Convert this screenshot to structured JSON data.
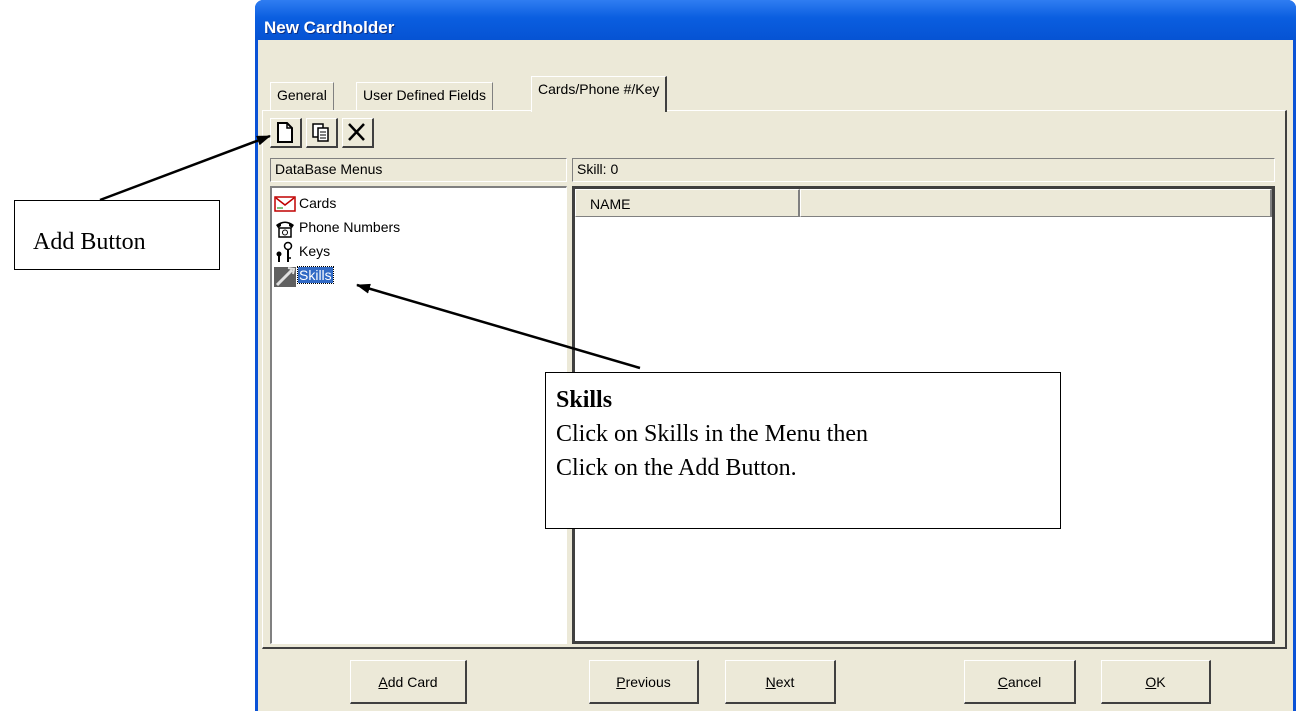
{
  "window": {
    "title": "New Cardholder"
  },
  "tabs": [
    {
      "label": "General",
      "active": false
    },
    {
      "label": "User Defined Fields",
      "active": false
    },
    {
      "label": "Cards/Phone #/Key",
      "active": true
    }
  ],
  "toolbar": [
    {
      "name": "add",
      "icon": "new-document-icon"
    },
    {
      "name": "copy",
      "icon": "copy-icon"
    },
    {
      "name": "delete",
      "icon": "delete-x-icon"
    }
  ],
  "left_pane": {
    "header": "DataBase Menus",
    "items": [
      {
        "label": "Cards",
        "icon": "card-icon"
      },
      {
        "label": "Phone Numbers",
        "icon": "phone-icon"
      },
      {
        "label": "Keys",
        "icon": "key-icon"
      },
      {
        "label": "Skills",
        "icon": "skills-icon",
        "selected": true
      }
    ]
  },
  "right_pane": {
    "header": "Skill:  0",
    "columns": [
      "NAME",
      ""
    ]
  },
  "buttons": {
    "add_card": {
      "mnemonic": "A",
      "rest": "dd Card"
    },
    "previous": {
      "mnemonic": "P",
      "rest": "revious"
    },
    "next": {
      "mnemonic": "N",
      "rest": "ext"
    },
    "cancel": {
      "mnemonic": "C",
      "rest": "ancel"
    },
    "ok": {
      "mnemonic": "O",
      "rest": "K"
    }
  },
  "annotations": {
    "add_button": "Add Button",
    "skills_title": "Skills",
    "skills_line1": "Click on Skills in the Menu then",
    "skills_line2": "Click on the Add Button."
  },
  "colors": {
    "titlebar": "#0a5ee0",
    "dialog_bg": "#ece9d8",
    "selection": "#316ac5"
  }
}
